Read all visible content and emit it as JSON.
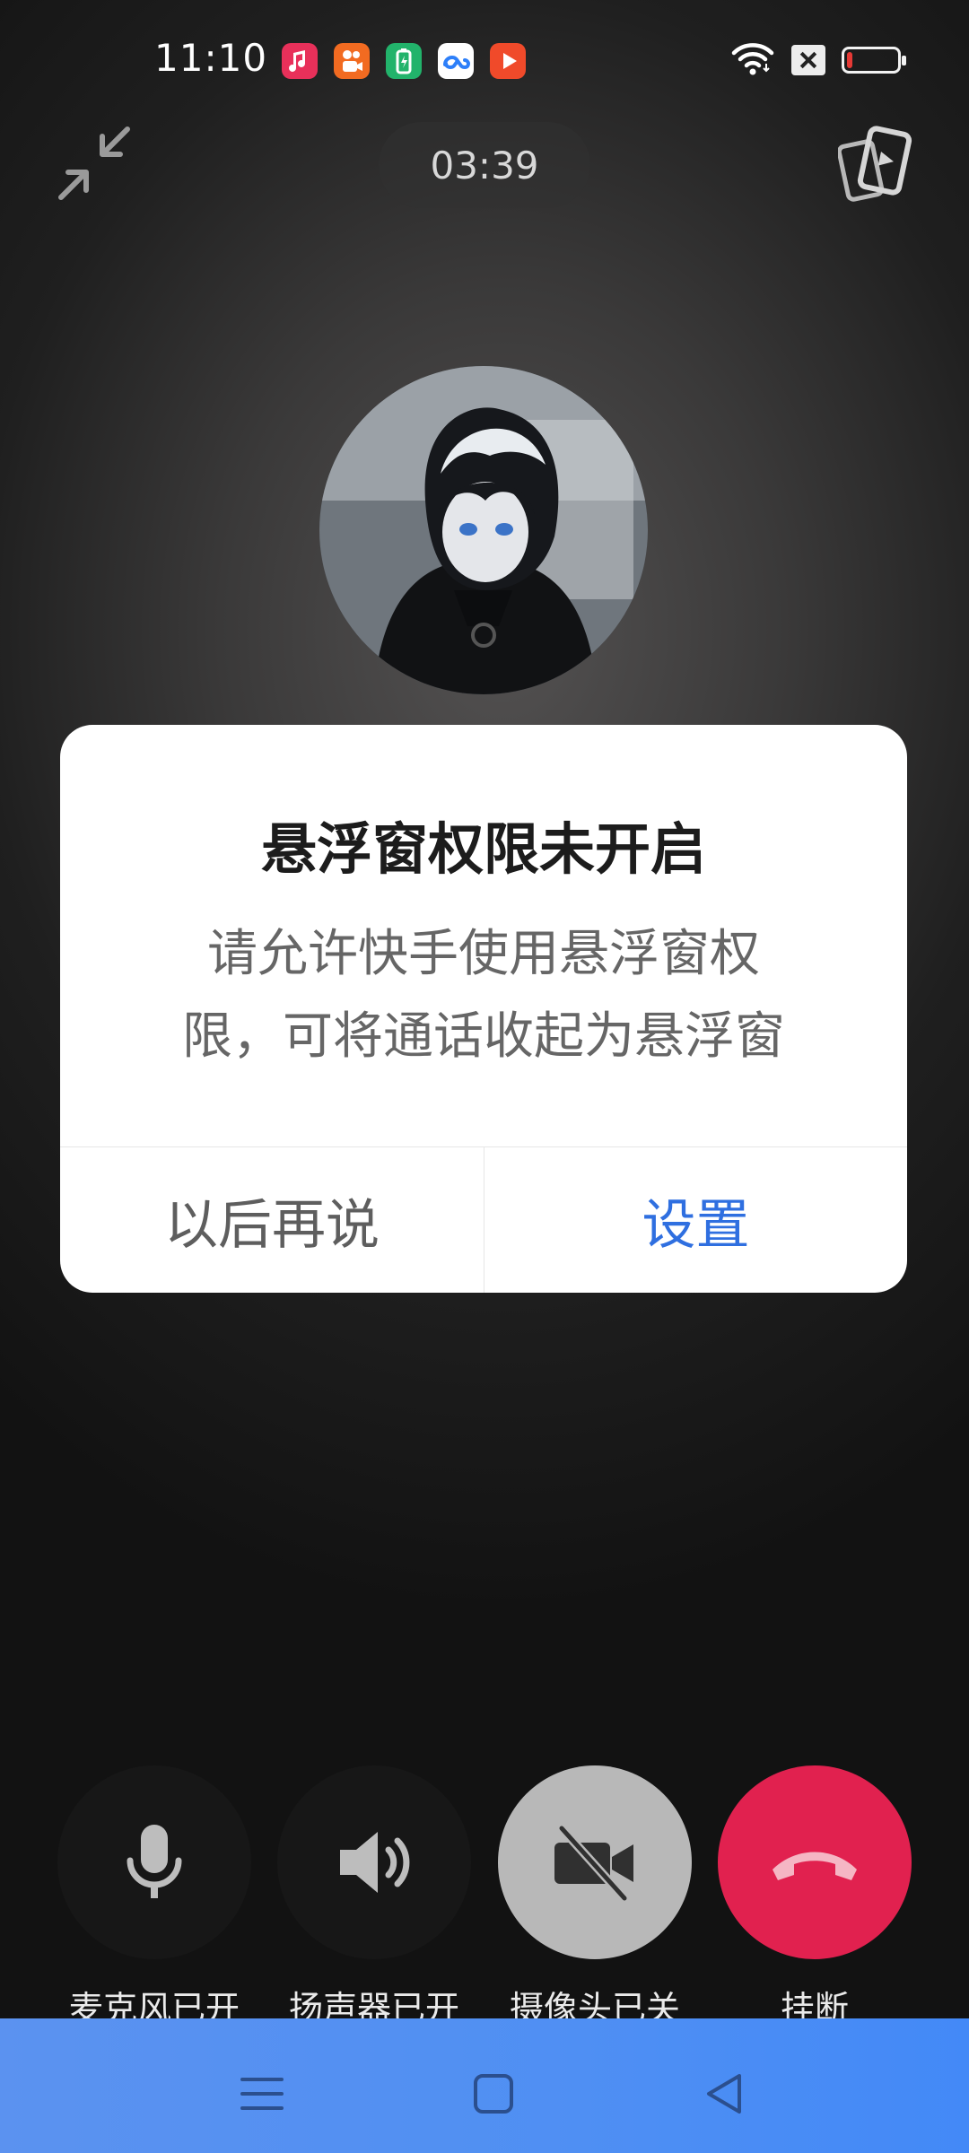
{
  "status_bar": {
    "time": "11:10",
    "app_icons": [
      {
        "name": "music-app-icon",
        "color": "#e8305a"
      },
      {
        "name": "kuaishou-speed-app-icon",
        "color": "#f26b21"
      },
      {
        "name": "battery-app-icon",
        "color": "#22b36b"
      },
      {
        "name": "cloud-drive-app-icon",
        "color": "#2d7ff9"
      },
      {
        "name": "video-play-app-icon",
        "color": "#f04a2a"
      }
    ],
    "battery_level": 0.12
  },
  "call": {
    "duration": "03:39"
  },
  "dialog": {
    "title": "悬浮窗权限未开启",
    "message_line1": "请允许快手使用悬浮窗权",
    "message_line2": "限，可将通话收起为悬浮窗",
    "later_label": "以后再说",
    "settings_label": "设置"
  },
  "controls": {
    "mic_label": "麦克风已开",
    "speaker_label": "扬声器已开",
    "camera_label": "摄像头已关",
    "hangup_label": "挂断"
  },
  "colors": {
    "accent": "#2f6fe0",
    "hangup": "#e1214f",
    "nav_bar": "#4f8ff3"
  }
}
